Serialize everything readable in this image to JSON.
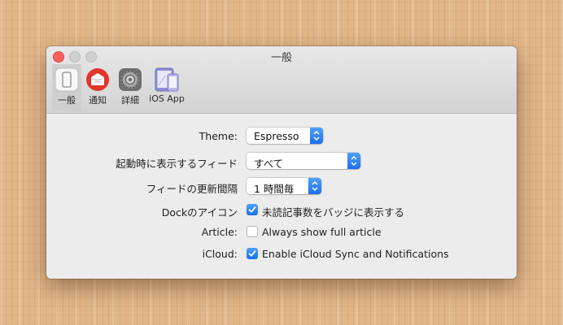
{
  "window": {
    "title": "一般",
    "controls": {
      "close": "close-button",
      "minimize": "minimize-button",
      "zoom": "zoom-button"
    }
  },
  "tabs": [
    {
      "label": "一般",
      "icon": "general-icon",
      "active": true
    },
    {
      "label": "通知",
      "icon": "notification-icon",
      "active": false
    },
    {
      "label": "詳細",
      "icon": "gear-icon",
      "active": false
    },
    {
      "label": "iOS App",
      "icon": "ios-devices-icon",
      "active": false
    }
  ],
  "settings": {
    "theme": {
      "label": "Theme:",
      "value": "Espresso"
    },
    "startup_feed": {
      "label": "起動時に表示するフィード",
      "value": "すべて"
    },
    "refresh_interval": {
      "label": "フィードの更新間隔",
      "value": "1 時間毎"
    },
    "dock_icon": {
      "label": "Dockのアイコン",
      "checkbox_label": "未読記事数をバッジに表示する",
      "checked": true
    },
    "article": {
      "label": "Article:",
      "checkbox_label": "Always show full article",
      "checked": false
    },
    "icloud": {
      "label": "iCloud:",
      "checkbox_label": "Enable iCloud Sync and Notifications",
      "checked": true
    }
  },
  "colors": {
    "accent": "#1b6fec",
    "close": "#fc605c",
    "desktop": "#e2b88a"
  }
}
